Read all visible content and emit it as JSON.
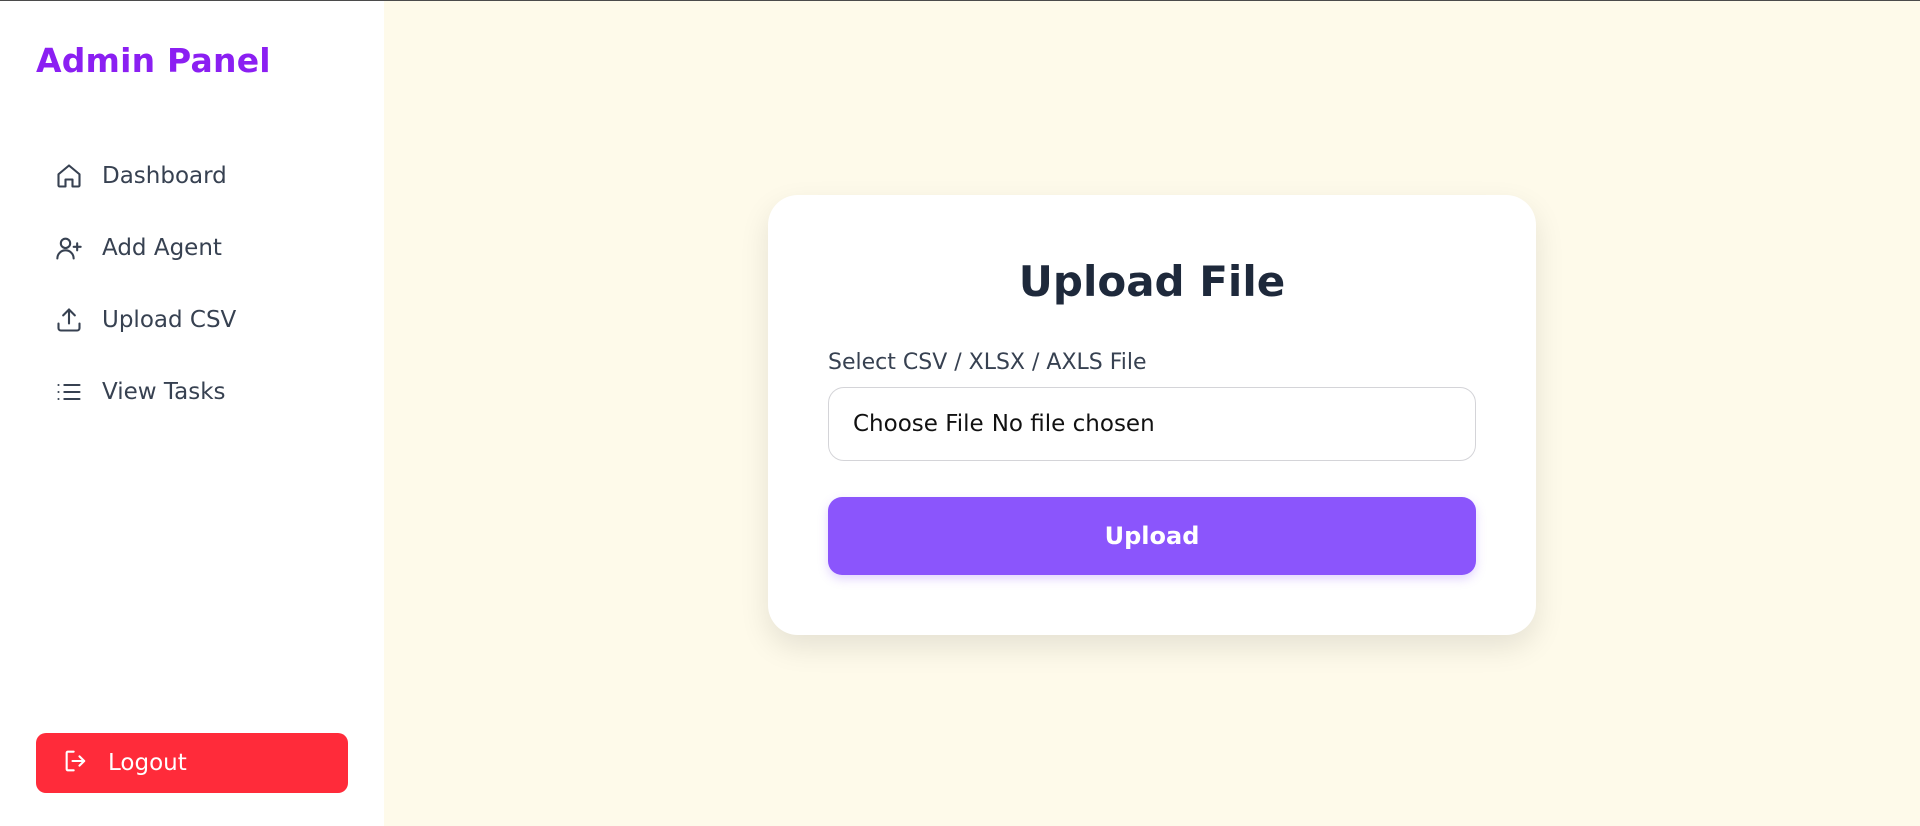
{
  "sidebar": {
    "brand": "Admin Panel",
    "items": [
      {
        "label": "Dashboard",
        "icon": "home-icon"
      },
      {
        "label": "Add Agent",
        "icon": "user-plus-icon"
      },
      {
        "label": "Upload CSV",
        "icon": "upload-icon"
      },
      {
        "label": "View Tasks",
        "icon": "list-icon"
      }
    ],
    "logout": {
      "label": "Logout",
      "icon": "logout-icon"
    }
  },
  "card": {
    "title": "Upload File",
    "field_label": "Select CSV / XLSX / AXLS File",
    "file_button": "Choose File",
    "file_status": "No file chosen",
    "submit_label": "Upload"
  },
  "colors": {
    "brand": "#8b1ff2",
    "accent": "#8b55fc",
    "danger": "#ff2b3a",
    "background": "#fefaea"
  }
}
